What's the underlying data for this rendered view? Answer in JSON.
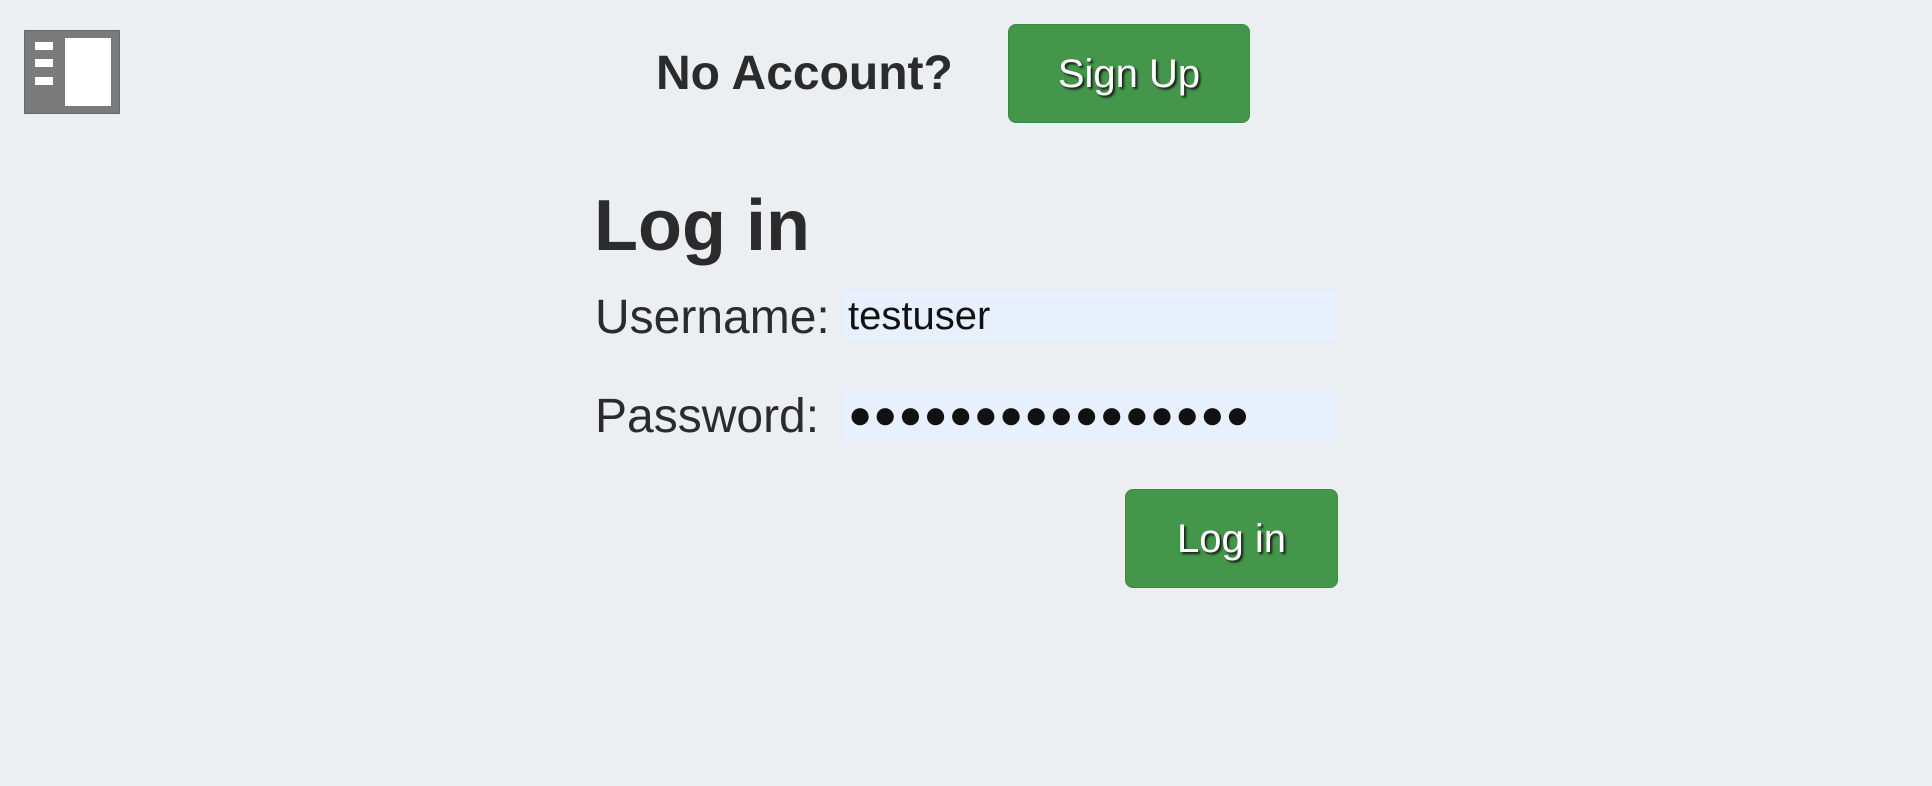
{
  "header": {
    "no_account_text": "No Account?",
    "signup_label": "Sign Up",
    "sidebar_toggle_icon": "sidebar-toggle-icon"
  },
  "login": {
    "title": "Log in",
    "username_label": "Username:",
    "username_value": "testuser",
    "password_label": "Password:",
    "password_value": "●●●●●●●●●●●●●●●●",
    "submit_label": "Log in"
  },
  "colors": {
    "background": "#eceff2",
    "button_green": "#43964a",
    "input_fill": "#e8f0fd",
    "icon_gray": "#7b7b7b"
  }
}
